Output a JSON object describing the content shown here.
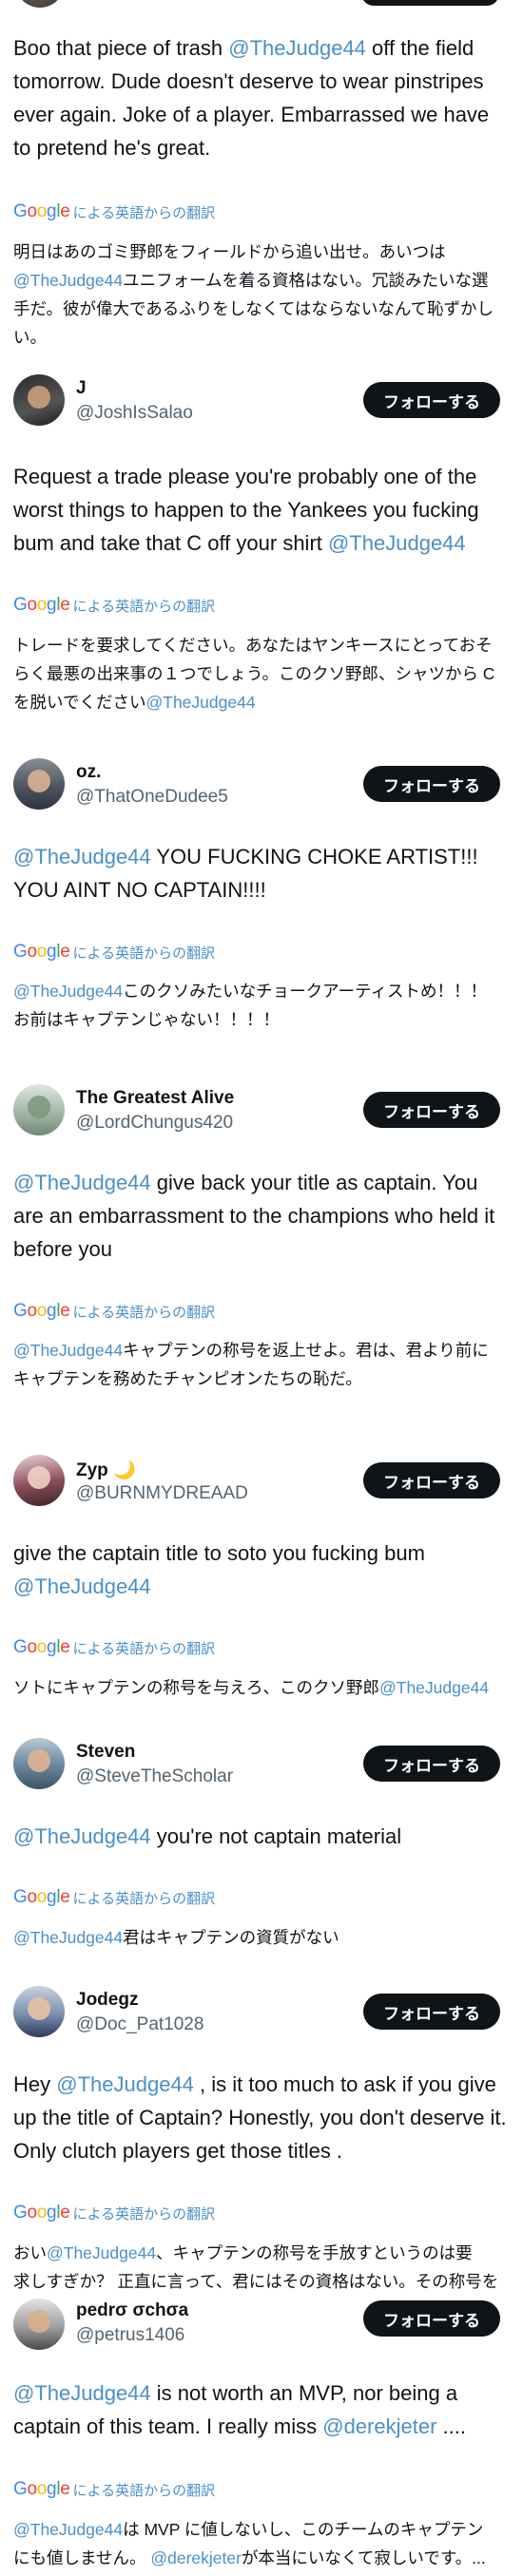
{
  "google_logo": "Google",
  "translated_note": "による英語からの翻訳",
  "follow_label": "フォローする",
  "mention_judge": "@TheJudge44",
  "mention_jeter": "@derekjeter",
  "tweets": [
    {
      "body_main": " off the field tomorrow. Dude doesn't deserve to wear pinstripes ever again. Joke of a player. Embarrassed we have to pretend he's great.",
      "body_prefix": "Boo that piece of trash ",
      "jp_line1": "明日はあのゴミ野郎をフィールドから追い出せ。あいつは",
      "jp_line2_rest": "ユニフォームを着る資格はない。冗談みたいな選",
      "jp_line3": "手だ。彼が偉大であるふりをしなくてはならないなんて恥ずかしい。"
    },
    {
      "name": "J",
      "handle": "@JoshIsSalao",
      "body_main": "Request a trade please you're probably one of the worst things to happen to the Yankees you fucking bum and take that C off your shirt ",
      "jp_line1": "トレードを要求してください。あなたはヤンキースにとっておそ",
      "jp_line2": "らく最悪の出来事の１つでしょう。このクソ野郎、シャツから C",
      "jp_line3_prefix": "を脱いでください"
    },
    {
      "name": "oz.",
      "handle": "@ThatOneDudee5",
      "body_rest": " YOU FUCKING CHOKE ARTIST!!! YOU AINT NO CAPTAIN!!!!",
      "jp_line1_rest": "このクソみたいなチョークアーティストめ！！！",
      "jp_line2": "お前はキャプテンじゃない！！！！"
    },
    {
      "name": "The Greatest Alive",
      "handle": "@LordChungus420",
      "body_rest": " give back your title as captain. You are an embarrassment to the champions who held it before you",
      "jp_line1_rest": "キャプテンの称号を返上せよ。君は、君より前に",
      "jp_line2": "キャプテンを務めたチャンピオンたちの恥だ。"
    },
    {
      "name": "Zyp 🌙",
      "handle": "@BURNMYDREAAD",
      "body_main": "give the captain title to soto you fucking bum",
      "jp_line1_prefix": "ソトにキャプテンの称号を与えろ、このクソ野郎"
    },
    {
      "name": "Steven",
      "handle": "@SteveTheScholar",
      "body_rest": " you're not captain material",
      "jp_line1_rest": "君はキャプテンの資質がない"
    },
    {
      "name": "Jodegz",
      "handle": "@Doc_Pat1028",
      "body_prefix": "Hey ",
      "body_rest": " , is it too much to ask if you give up the title of Captain?  Honestly, you don't deserve it. Only clutch players get those titles .",
      "jp_line1_prefix": "おい",
      "jp_line1_rest": "、キャプテンの称号を手放すというのは要",
      "jp_line2": "求しすぎか？ 正直に言って、君にはその資格はない。その称号を"
    },
    {
      "name": "pedrσ σchσa",
      "handle": "@petrus1406",
      "body_rest": " is not worth an MVP, nor being a captain of this team. I really miss ",
      "body_end": " ....",
      "jp_line1_rest": "は MVP に値しないし、このチームのキャプテン",
      "jp_line2_prefix": "にも値しません。 ",
      "jp_line2_rest": "が本当にいなくて寂しいです。..."
    }
  ]
}
